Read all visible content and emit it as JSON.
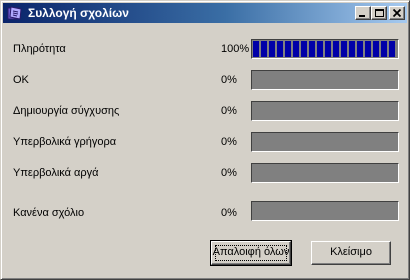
{
  "window": {
    "title": "Συλλογή σχολίων",
    "icon": "app-icon",
    "controls": {
      "minimize": "minimize-icon",
      "maximize": "maximize-icon",
      "close": "close-icon"
    }
  },
  "rows": [
    {
      "label": "Πληρότητα",
      "percent_text": "100%",
      "value": 1.0
    },
    {
      "label": "OK",
      "percent_text": "0%",
      "value": 0
    },
    {
      "label": "Δημιουργία σύγχυσης",
      "percent_text": "0%",
      "value": 0
    },
    {
      "label": "Υπερβολικά γρήγορα",
      "percent_text": "0%",
      "value": 0
    },
    {
      "label": "Υπερβολικά αργά",
      "percent_text": "0%",
      "value": 0
    },
    {
      "label": "Κανένα σχόλιο",
      "percent_text": "0%",
      "value": 0
    }
  ],
  "buttons": {
    "clear_all": "Απαλοιφή όλων",
    "close": "Κλείσιμο"
  },
  "colors": {
    "titlebar_start": "#0a246a",
    "titlebar_end": "#a6caf0",
    "progress_fill": "#0000a8",
    "progress_track": "#808080",
    "face": "#d4d0c8"
  }
}
